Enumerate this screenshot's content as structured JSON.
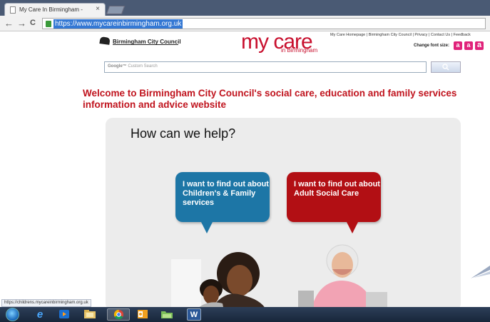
{
  "browser": {
    "tab_title": "My Care In Birmingham -",
    "tab_close": "×",
    "nav_back": "←",
    "nav_forward": "→",
    "nav_reload": "C",
    "url": "https://www.mycareinbirmingham.org.uk"
  },
  "header": {
    "council_logo_text": "Birmingham City Council",
    "brand_main": "my care",
    "brand_sub": "in Birmingham",
    "top_links": "My Care Homepage | Birmingham City Council | Privacy | Contact Us | Feedback",
    "change_font_size_label": "Change font size:",
    "font_size_buttons": [
      "a",
      "a",
      "a"
    ]
  },
  "search": {
    "google_label": "Google™",
    "placeholder": "Custom Search",
    "button_icon": "magnifier-icon"
  },
  "main": {
    "welcome_text": "Welcome to Birmingham City Council's social care, education and family services information and advice website",
    "help_title": "How can we help?",
    "bubble_children": "I want to find out about Children's & Family services",
    "bubble_adult": "I want to find out about Adult Social Care"
  },
  "status": {
    "link_preview": "https://childrens.mycareinbirmingham.org.uk"
  },
  "taskbar": {
    "icons": [
      "windows-start-icon",
      "internet-explorer-icon",
      "media-player-icon",
      "file-explorer-icon",
      "chrome-icon",
      "outlook-icon",
      "folder-icon",
      "word-icon"
    ]
  },
  "colors": {
    "brand_red": "#c0141e",
    "bubble_blue": "#1d76a6",
    "bubble_red": "#b20f14",
    "font_button_pink": "#e0227a"
  }
}
